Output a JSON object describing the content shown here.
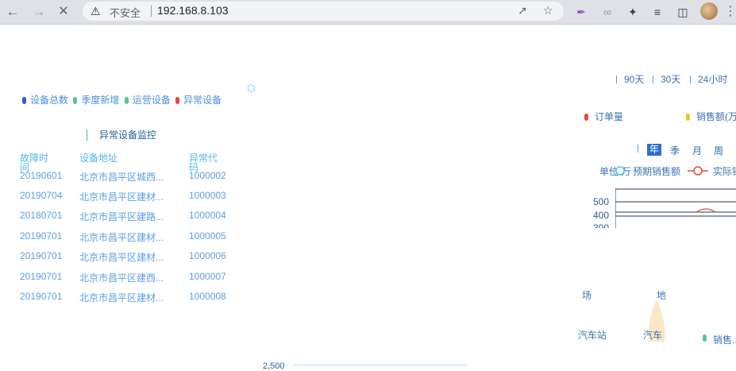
{
  "browser": {
    "back_icon": "back-arrow-icon",
    "forward_icon": "forward-arrow-icon",
    "stop_icon": "close-icon",
    "security_label": "不安全",
    "url": "192.168.8.103"
  },
  "legend": {
    "items": [
      {
        "label": "设备总数",
        "color": "#2a62d6"
      },
      {
        "label": "季度新增",
        "color": "#59c49a"
      },
      {
        "label": "运营设备",
        "color": "#59c49a"
      },
      {
        "label": "异常设备",
        "color": "#e5483f"
      }
    ]
  },
  "abnormal_panel": {
    "title": "异常设备监控",
    "columns": [
      "故障时间",
      "设备地址",
      "异常代码"
    ],
    "rows": [
      {
        "date": "20190601",
        "address": "北京市昌平区城西...",
        "code": "1000002"
      },
      {
        "date": "20190704",
        "address": "北京市昌平区建材...",
        "code": "1000003"
      },
      {
        "date": "20180701",
        "address": "北京市昌平区建路...",
        "code": "1000004"
      },
      {
        "date": "20190701",
        "address": "北京市昌平区建材...",
        "code": "1000005"
      },
      {
        "date": "20190701",
        "address": "北京市昌平区建材...",
        "code": "1000006"
      },
      {
        "date": "20190701",
        "address": "北京市昌平区建西...",
        "code": "1000007"
      },
      {
        "date": "20190701",
        "address": "北京市昌平区建材...",
        "code": "1000008"
      }
    ]
  },
  "ranges": [
    "90天",
    "30天",
    "24小时"
  ],
  "series_legend": [
    {
      "label": "订单量",
      "color": "#e5483f"
    },
    {
      "label": "销售额(万",
      "color": "#f0c419"
    }
  ],
  "periods": {
    "year": "年",
    "quarter": "季",
    "month": "月",
    "week": "周"
  },
  "sales_chart": {
    "unit_label": "单位:万",
    "legend_expected": "预期销售额",
    "legend_actual": "实际销",
    "y_ticks": [
      "500",
      "400",
      "300"
    ]
  },
  "partial_labels": {
    "a": "场",
    "b": "地",
    "c": "汽车站",
    "d": "汽车",
    "e": "销售..."
  },
  "bottom_tick": "2,500"
}
